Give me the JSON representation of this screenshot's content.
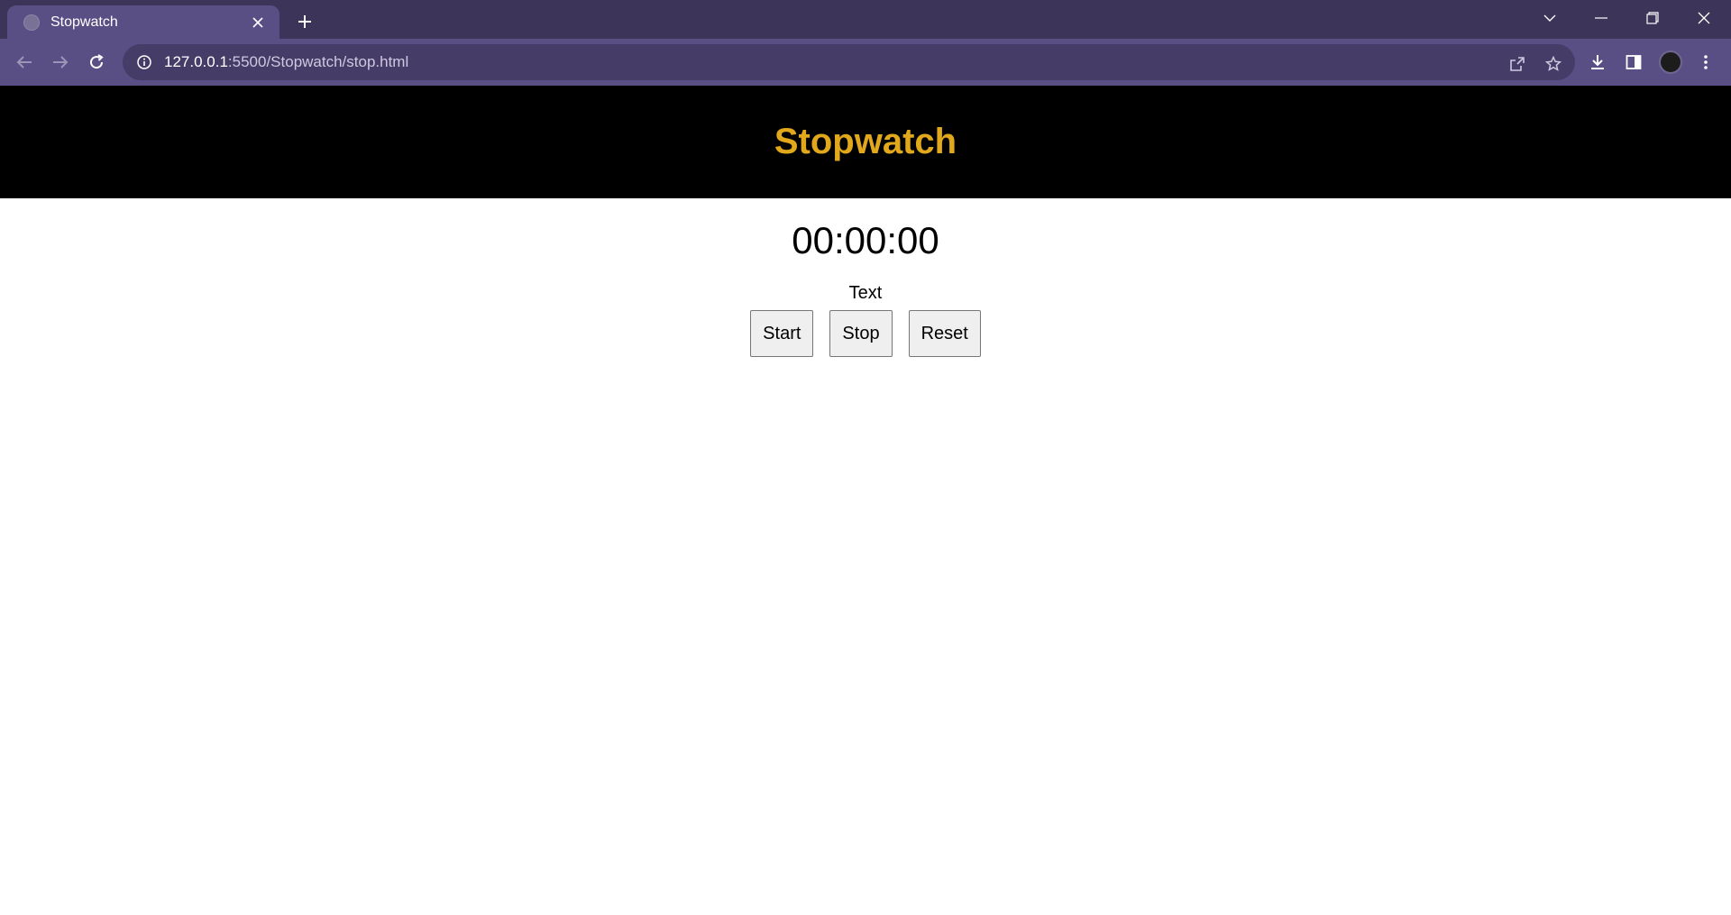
{
  "browser": {
    "tab_title": "Stopwatch",
    "url_host": "127.0.0.1",
    "url_rest": ":5500/Stopwatch/stop.html",
    "icons": [
      "tab-search-icon",
      "minimize-icon",
      "restore-icon",
      "close-icon",
      "back-icon",
      "forward-icon",
      "reload-icon",
      "info-icon",
      "share-icon",
      "star-icon",
      "download-icon",
      "side-panel-icon",
      "avatar",
      "menu-icon"
    ]
  },
  "page": {
    "title": "Stopwatch",
    "time": "00:00:00",
    "label": "Text",
    "buttons": {
      "start": "Start",
      "stop": "Stop",
      "reset": "Reset"
    }
  },
  "colors": {
    "header_bg": "#000000",
    "title_color": "#e0a81a",
    "chrome_frame": "#3c3459",
    "chrome_toolbar": "#5a4f85"
  }
}
